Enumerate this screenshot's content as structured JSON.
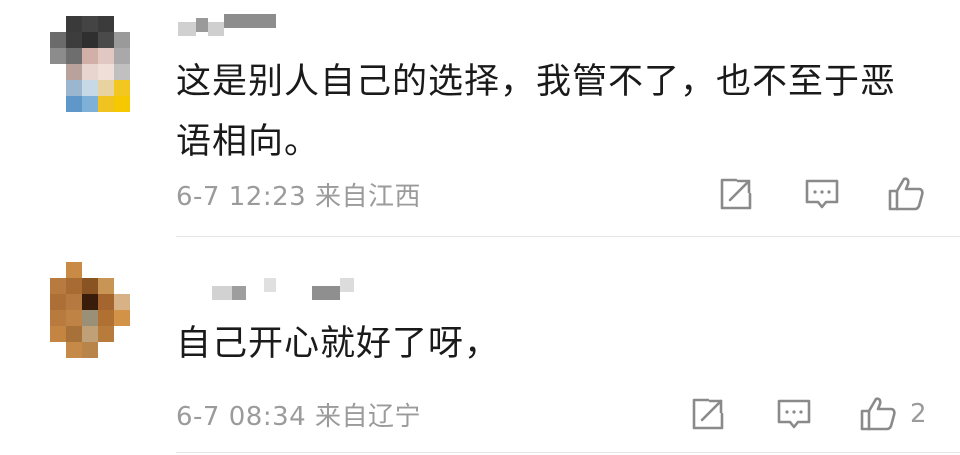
{
  "comments": [
    {
      "text_line1": "这是别人自己的选择，我管不了，也不至于恶",
      "text_line2": "语相向。",
      "timestamp": "6-7 12:23",
      "location": "来自江西",
      "like_count": "",
      "avatar_state": "pixelated",
      "username_state": "pixelated",
      "icons": [
        "share-icon",
        "comment-icon",
        "thumbs-up-icon"
      ]
    },
    {
      "text_line1": "自己开心就好了呀，",
      "text_line2": "",
      "timestamp": "6-7 08:34",
      "location": "来自辽宁",
      "like_count": "2",
      "avatar_state": "pixelated",
      "username_state": "pixelated",
      "icons": [
        "share-icon",
        "comment-icon",
        "thumbs-up-icon"
      ]
    }
  ],
  "colors": {
    "text": "#1a1a1a",
    "meta": "#9b9b9b",
    "icon": "#8a8a8a",
    "divider": "#e6e6e6"
  }
}
